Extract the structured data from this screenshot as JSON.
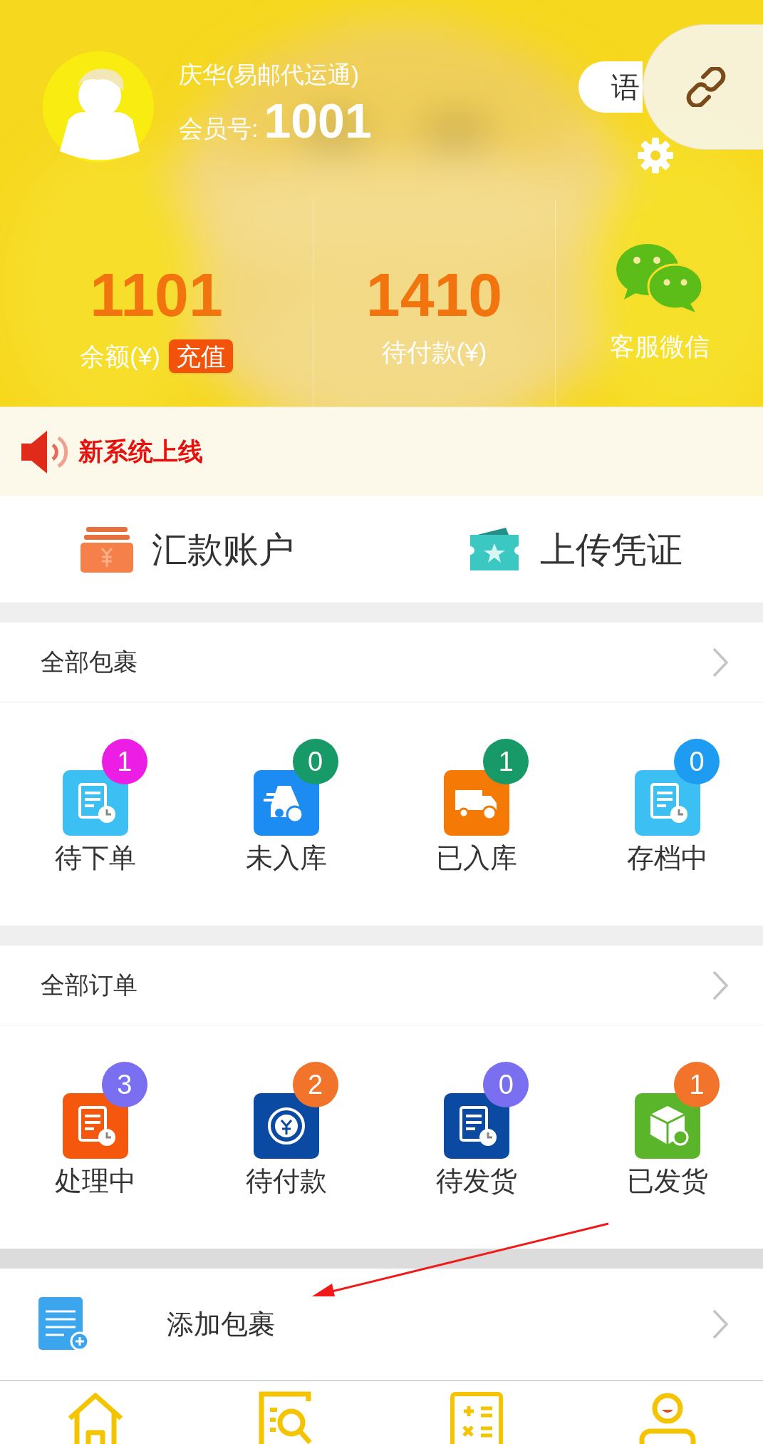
{
  "header": {
    "user_name": "庆华(易邮代运通)",
    "member_label": "会员号:",
    "member_no": "1001",
    "language_button": "语",
    "stats": [
      {
        "kind": "amount",
        "value": "1101",
        "label": "余额(¥)",
        "action": "充值"
      },
      {
        "kind": "amount",
        "value": "1410",
        "label": "待付款(¥)"
      },
      {
        "kind": "wechat",
        "label": "客服微信"
      }
    ]
  },
  "notice": "新系统上线",
  "quick_links": [
    {
      "kind": "bank",
      "label": "汇款账户"
    },
    {
      "kind": "ticket",
      "label": "上传凭证"
    }
  ],
  "sections": [
    {
      "title": "全部包裹",
      "items": [
        {
          "kind": "doc",
          "label": "待下单",
          "color": "#3cbff3",
          "badge": {
            "text": "1",
            "color": "#ec1ee6"
          }
        },
        {
          "kind": "car",
          "label": "未入库",
          "color": "#1d8cf2",
          "badge": {
            "text": "0",
            "color": "#179a68"
          }
        },
        {
          "kind": "truck",
          "label": "已入库",
          "color": "#f57a05",
          "badge": {
            "text": "1",
            "color": "#179a68"
          }
        },
        {
          "kind": "doc",
          "label": "存档中",
          "color": "#3cbff3",
          "badge": {
            "text": "0",
            "color": "#1e9cf2"
          }
        }
      ]
    },
    {
      "title": "全部订单",
      "items": [
        {
          "kind": "doc",
          "label": "处理中",
          "color": "#f5580c",
          "badge": {
            "text": "3",
            "color": "#7a6ff0"
          }
        },
        {
          "kind": "coin",
          "label": "待付款",
          "color": "#0b4aa2",
          "badge": {
            "text": "2",
            "color": "#f2742a"
          }
        },
        {
          "kind": "doc",
          "label": "待发货",
          "color": "#0b4aa2",
          "badge": {
            "text": "0",
            "color": "#7a6ff0"
          }
        },
        {
          "kind": "box",
          "label": "已发货",
          "color": "#5bb52b",
          "badge": {
            "text": "1",
            "color": "#f2742a"
          }
        }
      ]
    }
  ],
  "add_package": {
    "label": "添加包裹"
  },
  "tab_bar": [
    {
      "kind": "home"
    },
    {
      "kind": "search"
    },
    {
      "kind": "calc"
    },
    {
      "kind": "profile"
    }
  ]
}
